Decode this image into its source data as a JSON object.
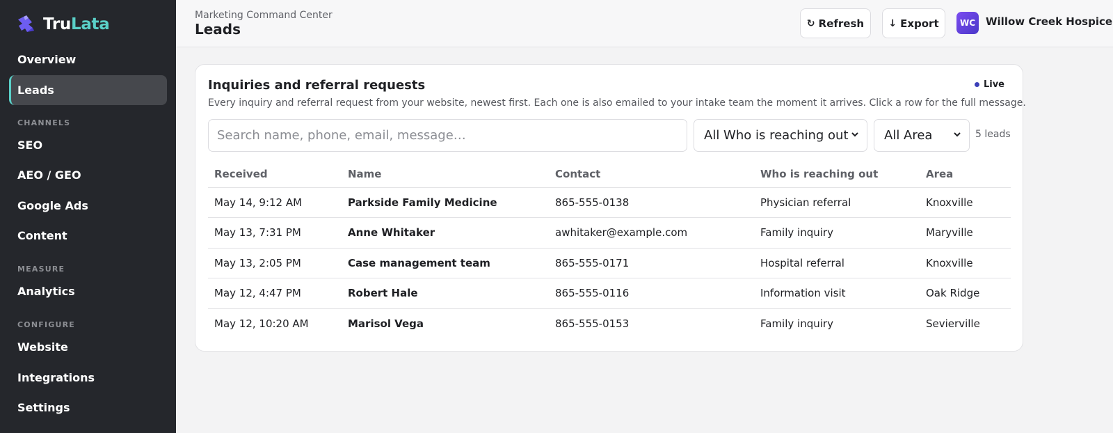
{
  "brand": {
    "part1": "Tru",
    "part2": "Lata"
  },
  "sidebar": {
    "items": [
      {
        "label": "Overview"
      },
      {
        "label": "Leads",
        "active": true
      }
    ],
    "groups": [
      {
        "label": "CHANNELS",
        "items": [
          "SEO",
          "AEO / GEO",
          "Google Ads",
          "Content"
        ]
      },
      {
        "label": "MEASURE",
        "items": [
          "Analytics"
        ]
      },
      {
        "label": "CONFIGURE",
        "items": [
          "Website",
          "Integrations",
          "Settings"
        ]
      }
    ]
  },
  "header": {
    "breadcrumb": "Marketing Command Center",
    "title": "Leads",
    "refresh_label": "Refresh",
    "export_label": "Export",
    "org_initials": "WC",
    "org_name": "Willow Creek Hospice"
  },
  "card": {
    "title": "Inquiries and referral requests",
    "live_label": "Live",
    "description": "Every inquiry and referral request from your website, newest first. Each one is also emailed to your intake team the moment it arrives. Click a row for the full message.",
    "search_placeholder": "Search name, phone, email, message…",
    "filter_who": "All Who is reaching out",
    "filter_area": "All Area",
    "count": "5 leads"
  },
  "table": {
    "columns": [
      "Received",
      "Name",
      "Contact",
      "Who is reaching out",
      "Area"
    ],
    "rows": [
      [
        "May 14, 9:12 AM",
        "Parkside Family Medicine",
        "865-555-0138",
        "Physician referral",
        "Knoxville"
      ],
      [
        "May 13, 7:31 PM",
        "Anne Whitaker",
        "awhitaker@example.com",
        "Family inquiry",
        "Maryville"
      ],
      [
        "May 13, 2:05 PM",
        "Case management team",
        "865-555-0171",
        "Hospital referral",
        "Knoxville"
      ],
      [
        "May 12, 4:47 PM",
        "Robert Hale",
        "865-555-0116",
        "Information visit",
        "Oak Ridge"
      ],
      [
        "May 12, 10:20 AM",
        "Marisol Vega",
        "865-555-0153",
        "Family inquiry",
        "Sevierville"
      ]
    ]
  },
  "colors": {
    "accent": "#5ad0c8",
    "sidebar_bg": "#25272c",
    "live_dot": "#3b3fb8",
    "avatar": "#5b3fd8"
  }
}
